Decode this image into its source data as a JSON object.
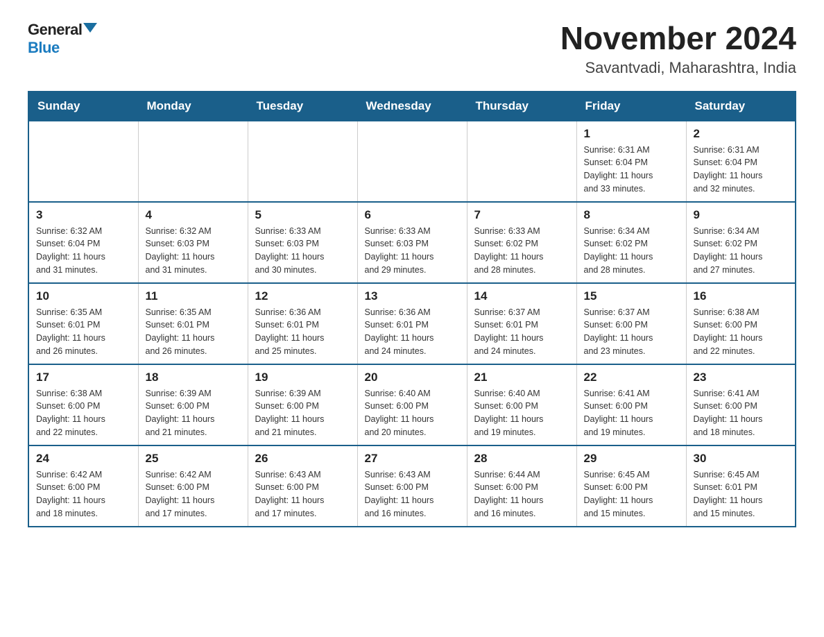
{
  "logo": {
    "general": "General",
    "blue": "Blue"
  },
  "title": "November 2024",
  "subtitle": "Savantvadi, Maharashtra, India",
  "days_of_week": [
    "Sunday",
    "Monday",
    "Tuesday",
    "Wednesday",
    "Thursday",
    "Friday",
    "Saturday"
  ],
  "weeks": [
    [
      {
        "day": "",
        "info": ""
      },
      {
        "day": "",
        "info": ""
      },
      {
        "day": "",
        "info": ""
      },
      {
        "day": "",
        "info": ""
      },
      {
        "day": "",
        "info": ""
      },
      {
        "day": "1",
        "info": "Sunrise: 6:31 AM\nSunset: 6:04 PM\nDaylight: 11 hours\nand 33 minutes."
      },
      {
        "day": "2",
        "info": "Sunrise: 6:31 AM\nSunset: 6:04 PM\nDaylight: 11 hours\nand 32 minutes."
      }
    ],
    [
      {
        "day": "3",
        "info": "Sunrise: 6:32 AM\nSunset: 6:04 PM\nDaylight: 11 hours\nand 31 minutes."
      },
      {
        "day": "4",
        "info": "Sunrise: 6:32 AM\nSunset: 6:03 PM\nDaylight: 11 hours\nand 31 minutes."
      },
      {
        "day": "5",
        "info": "Sunrise: 6:33 AM\nSunset: 6:03 PM\nDaylight: 11 hours\nand 30 minutes."
      },
      {
        "day": "6",
        "info": "Sunrise: 6:33 AM\nSunset: 6:03 PM\nDaylight: 11 hours\nand 29 minutes."
      },
      {
        "day": "7",
        "info": "Sunrise: 6:33 AM\nSunset: 6:02 PM\nDaylight: 11 hours\nand 28 minutes."
      },
      {
        "day": "8",
        "info": "Sunrise: 6:34 AM\nSunset: 6:02 PM\nDaylight: 11 hours\nand 28 minutes."
      },
      {
        "day": "9",
        "info": "Sunrise: 6:34 AM\nSunset: 6:02 PM\nDaylight: 11 hours\nand 27 minutes."
      }
    ],
    [
      {
        "day": "10",
        "info": "Sunrise: 6:35 AM\nSunset: 6:01 PM\nDaylight: 11 hours\nand 26 minutes."
      },
      {
        "day": "11",
        "info": "Sunrise: 6:35 AM\nSunset: 6:01 PM\nDaylight: 11 hours\nand 26 minutes."
      },
      {
        "day": "12",
        "info": "Sunrise: 6:36 AM\nSunset: 6:01 PM\nDaylight: 11 hours\nand 25 minutes."
      },
      {
        "day": "13",
        "info": "Sunrise: 6:36 AM\nSunset: 6:01 PM\nDaylight: 11 hours\nand 24 minutes."
      },
      {
        "day": "14",
        "info": "Sunrise: 6:37 AM\nSunset: 6:01 PM\nDaylight: 11 hours\nand 24 minutes."
      },
      {
        "day": "15",
        "info": "Sunrise: 6:37 AM\nSunset: 6:00 PM\nDaylight: 11 hours\nand 23 minutes."
      },
      {
        "day": "16",
        "info": "Sunrise: 6:38 AM\nSunset: 6:00 PM\nDaylight: 11 hours\nand 22 minutes."
      }
    ],
    [
      {
        "day": "17",
        "info": "Sunrise: 6:38 AM\nSunset: 6:00 PM\nDaylight: 11 hours\nand 22 minutes."
      },
      {
        "day": "18",
        "info": "Sunrise: 6:39 AM\nSunset: 6:00 PM\nDaylight: 11 hours\nand 21 minutes."
      },
      {
        "day": "19",
        "info": "Sunrise: 6:39 AM\nSunset: 6:00 PM\nDaylight: 11 hours\nand 21 minutes."
      },
      {
        "day": "20",
        "info": "Sunrise: 6:40 AM\nSunset: 6:00 PM\nDaylight: 11 hours\nand 20 minutes."
      },
      {
        "day": "21",
        "info": "Sunrise: 6:40 AM\nSunset: 6:00 PM\nDaylight: 11 hours\nand 19 minutes."
      },
      {
        "day": "22",
        "info": "Sunrise: 6:41 AM\nSunset: 6:00 PM\nDaylight: 11 hours\nand 19 minutes."
      },
      {
        "day": "23",
        "info": "Sunrise: 6:41 AM\nSunset: 6:00 PM\nDaylight: 11 hours\nand 18 minutes."
      }
    ],
    [
      {
        "day": "24",
        "info": "Sunrise: 6:42 AM\nSunset: 6:00 PM\nDaylight: 11 hours\nand 18 minutes."
      },
      {
        "day": "25",
        "info": "Sunrise: 6:42 AM\nSunset: 6:00 PM\nDaylight: 11 hours\nand 17 minutes."
      },
      {
        "day": "26",
        "info": "Sunrise: 6:43 AM\nSunset: 6:00 PM\nDaylight: 11 hours\nand 17 minutes."
      },
      {
        "day": "27",
        "info": "Sunrise: 6:43 AM\nSunset: 6:00 PM\nDaylight: 11 hours\nand 16 minutes."
      },
      {
        "day": "28",
        "info": "Sunrise: 6:44 AM\nSunset: 6:00 PM\nDaylight: 11 hours\nand 16 minutes."
      },
      {
        "day": "29",
        "info": "Sunrise: 6:45 AM\nSunset: 6:00 PM\nDaylight: 11 hours\nand 15 minutes."
      },
      {
        "day": "30",
        "info": "Sunrise: 6:45 AM\nSunset: 6:01 PM\nDaylight: 11 hours\nand 15 minutes."
      }
    ]
  ]
}
